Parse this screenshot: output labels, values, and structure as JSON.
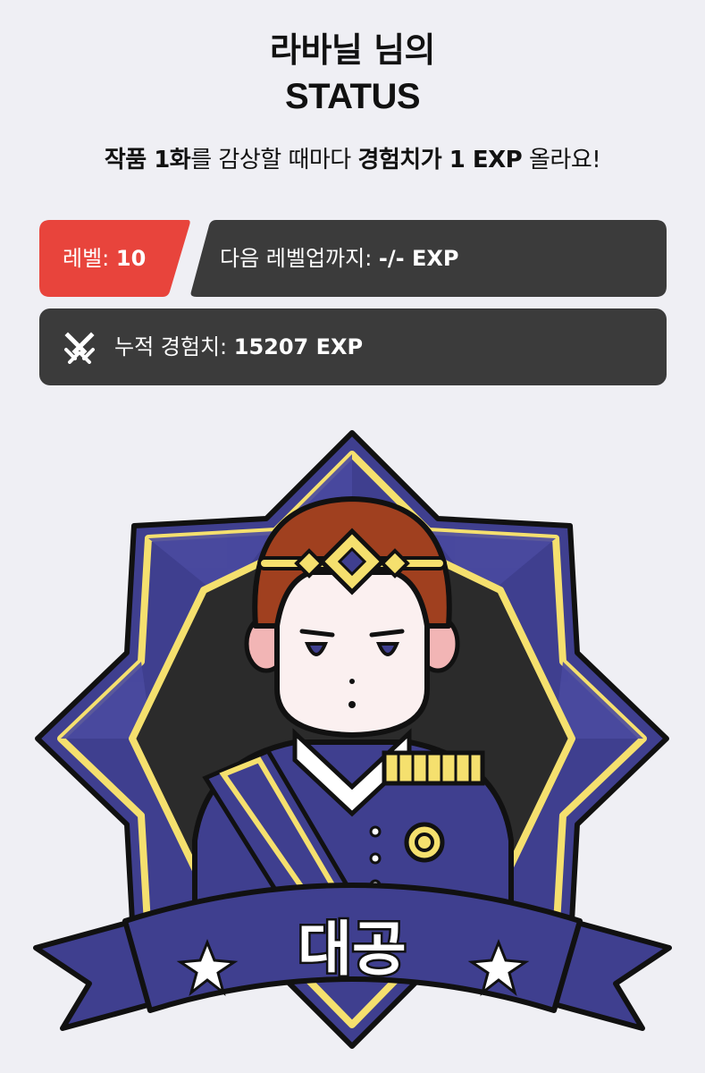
{
  "header": {
    "title_line1": "라바닐 님의",
    "title_line2": "STATUS"
  },
  "subtitle": {
    "bold1": "작품 1화",
    "text1": "를 감상할 때마다 ",
    "bold2": "경험치가 1 EXP",
    "text2": " 올라요!"
  },
  "level": {
    "label": "레벨: ",
    "value": "10",
    "color": "#e8443c"
  },
  "next_level": {
    "label": "다음 레벨업까지: ",
    "value": "-/- EXP"
  },
  "total_exp": {
    "icon": "crossed-swords-icon",
    "label": "누적 경험치: ",
    "value": "15207 EXP"
  },
  "badge": {
    "title": "대공",
    "colors": {
      "navy": "#3f3f8f",
      "yellow": "#f5e06e",
      "dark": "#2b2b2b",
      "hair": "#a0401f"
    }
  }
}
